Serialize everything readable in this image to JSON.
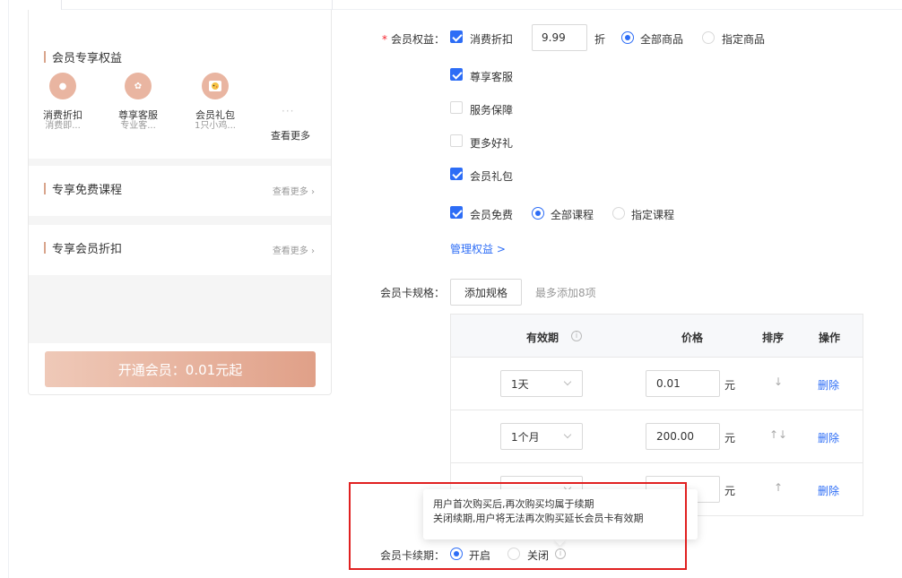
{
  "preview": {
    "section_benefits": "会员专享权益",
    "benefits": [
      {
        "name": "消费折扣",
        "desc": "消费即..."
      },
      {
        "name": "尊享客服",
        "desc": "专业客..."
      },
      {
        "name": "会员礼包",
        "desc": "1只小鸡..."
      }
    ],
    "see_more": "查看更多",
    "section_courses": "专享免费课程",
    "section_discount": "专享会员折扣",
    "more_link": "查看更多 ›",
    "open_button": "开通会员：0.01元起"
  },
  "form": {
    "benefits_label": "会员权益：",
    "required_mark": "*",
    "discount": {
      "label": "消费折扣",
      "checked": true,
      "value": "9.99",
      "unit": "折",
      "scope_all": "全部商品",
      "scope_some": "指定商品"
    },
    "options": [
      {
        "label": "尊享客服",
        "checked": true
      },
      {
        "label": "服务保障",
        "checked": false
      },
      {
        "label": "更多好礼",
        "checked": false
      },
      {
        "label": "会员礼包",
        "checked": true
      }
    ],
    "free": {
      "label": "会员免费",
      "checked": true,
      "scope_all": "全部课程",
      "scope_some": "指定课程"
    },
    "manage_link": "管理权益 >",
    "spec_label": "会员卡规格：",
    "add_spec": "添加规格",
    "spec_hint": "最多添加8项",
    "table": {
      "headers": {
        "validity": "有效期",
        "price": "价格",
        "sort": "排序",
        "action": "操作"
      },
      "rows": [
        {
          "validity": "1天",
          "price": "0.01",
          "unit": "元",
          "sort": "↓",
          "action": "删除"
        },
        {
          "validity": "1个月",
          "price": "200.00",
          "unit": "元",
          "sort": "↑↓",
          "action": "删除"
        },
        {
          "validity": "",
          "price": "",
          "unit": "元",
          "sort": "↑",
          "action": "删除"
        }
      ]
    },
    "tooltip": {
      "line1": "用户首次购买后,再次购买均属于续期",
      "line2": "关闭续期,用户将无法再次购买延长会员卡有效期"
    },
    "renew_label": "会员卡续期：",
    "renew_on": "开启",
    "renew_off": "关闭"
  },
  "colors": {
    "accent": "#2d6df6",
    "peach": "#e9b5a1",
    "highlight_box": "#e02020"
  }
}
